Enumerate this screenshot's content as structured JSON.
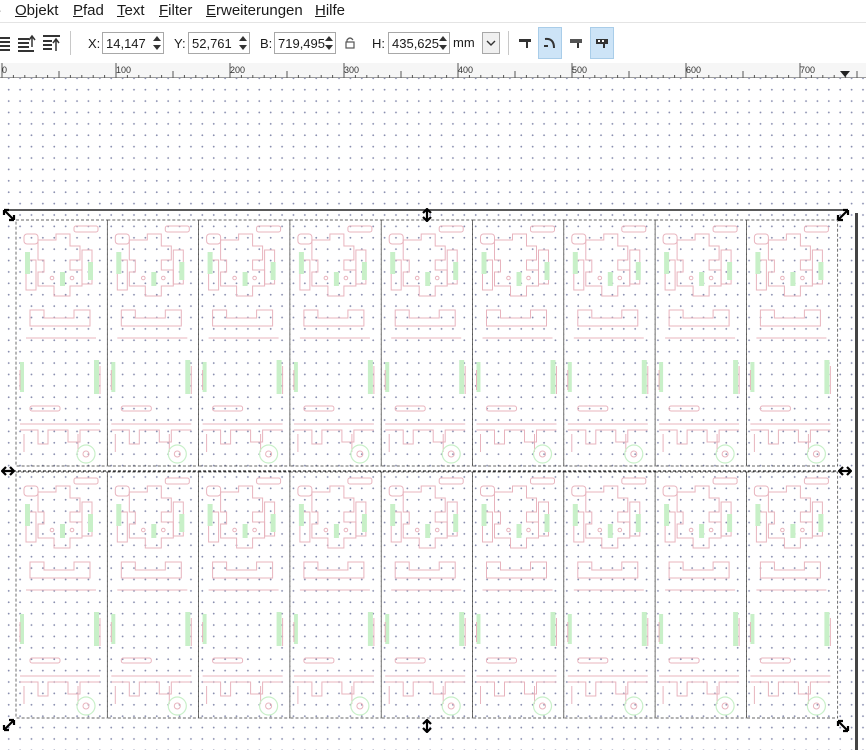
{
  "menu": {
    "items": [
      {
        "label": "Objekt",
        "accel": "O",
        "rest": "bjekt"
      },
      {
        "label": "Pfad",
        "accel": "P",
        "rest": "fad"
      },
      {
        "label": "Text",
        "accel": "T",
        "rest": "ext"
      },
      {
        "label": "Filter",
        "accel": "F",
        "rest": "ilter"
      },
      {
        "label": "Erweiterungen",
        "accel": "E",
        "rest": "rweiterungen"
      },
      {
        "label": "Hilfe",
        "accel": "H",
        "rest": "ilfe"
      }
    ]
  },
  "toolbar": {
    "x_label": "X:",
    "x_value": "14,147",
    "y_label": "Y:",
    "y_value": "52,761",
    "w_label": "B:",
    "w_value": "719,495",
    "lock_icon": "lock-icon",
    "h_label": "H:",
    "h_value": "435,625",
    "unit": "mm",
    "left_buttons": [
      "align-lower-icon",
      "raise-icon",
      "align-top-icon"
    ],
    "transform_buttons": [
      {
        "icon": "scale-stroke-icon",
        "active": false
      },
      {
        "icon": "scale-corners-icon",
        "active": true
      },
      {
        "icon": "transform-gradients-icon",
        "active": false
      },
      {
        "icon": "transform-patterns-icon",
        "active": true
      }
    ]
  },
  "ruler": {
    "labels": [
      "0",
      "100",
      "200",
      "300",
      "400",
      "500",
      "600",
      "700"
    ]
  },
  "colors": {
    "active_button": "#cde4f7",
    "grid_dot": "#8a8fb0",
    "cut_line": "#e8b4be",
    "engrave_fill": "#c8f0c8",
    "selection": "#000000"
  }
}
